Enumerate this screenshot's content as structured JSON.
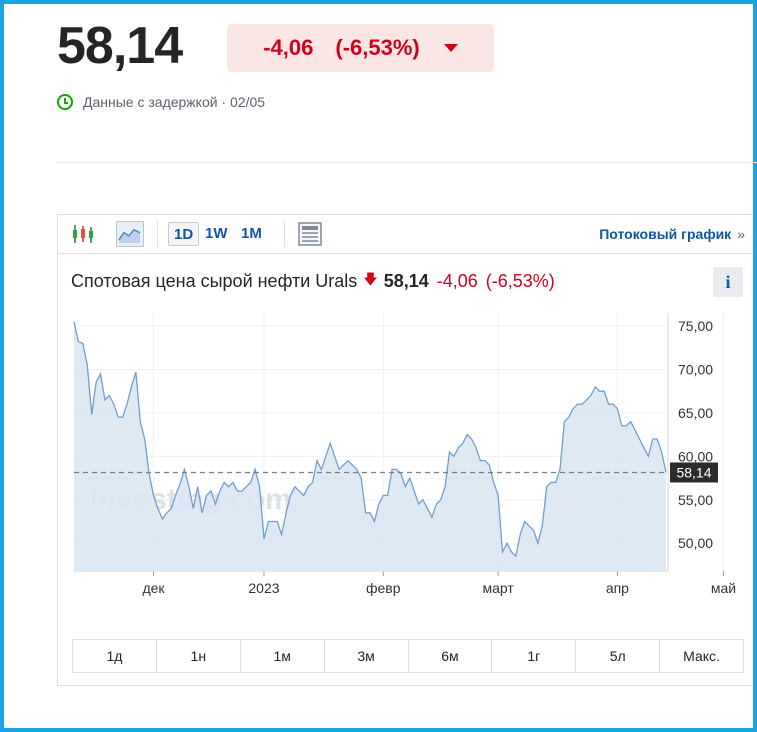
{
  "quote": {
    "price": "58,14",
    "change": "-4,06",
    "change_pct": "(-6,53%)",
    "delay_text": "Данные с задержкой · 02/05"
  },
  "toolbar": {
    "icons": [
      "candlestick-icon",
      "area-chart-icon",
      "table-icon"
    ],
    "timeframes": [
      "1D",
      "1W",
      "1M"
    ],
    "active_timeframe": "1D",
    "stream_label": "Потоковый график",
    "stream_chevron": "»"
  },
  "chart_header": {
    "title": "Спотовая цена сырой нефти Urals",
    "arrow": "🡇",
    "price": "58,14",
    "change": "-4,06",
    "change_pct": "(-6,53%)",
    "info": "i"
  },
  "chart_data": {
    "type": "area",
    "x_labels": [
      "дек",
      "2023",
      "февр",
      "март",
      "апр",
      "май"
    ],
    "y_ticks": [
      "75,00",
      "70,00",
      "65,00",
      "60,00",
      "55,00",
      "50,00"
    ],
    "ylim": [
      46.8,
      76.5
    ],
    "last_value_label": "58,14",
    "last_value": 58.14,
    "watermark": "Investing.com",
    "grid": true,
    "series": [
      {
        "values": [
          75.5,
          73.2,
          73.0,
          70.5,
          64.8,
          68.5,
          69.5,
          66.5,
          67.0,
          66.0,
          64.5,
          64.5,
          66.0,
          68.0,
          69.7,
          64.0,
          62.0,
          58.0,
          55.5,
          54.0,
          52.8,
          53.5,
          54.0,
          55.5,
          56.8,
          58.5,
          56.5,
          54.0,
          56.5,
          53.5,
          55.5,
          56.0,
          54.5,
          56.0,
          57.0,
          56.5,
          57.0,
          56.0,
          56.0,
          56.5,
          57.0,
          58.5,
          56.5,
          50.5,
          52.5,
          52.5,
          52.5,
          51.0,
          53.5,
          55.5,
          56.5,
          56.0,
          55.5,
          56.5,
          57.0,
          59.5,
          58.5,
          60.0,
          61.5,
          60.0,
          58.5,
          59.0,
          59.5,
          59.0,
          58.5,
          57.5,
          53.5,
          53.5,
          52.5,
          54.5,
          55.5,
          55.5,
          58.5,
          58.5,
          58.0,
          56.5,
          57.5,
          56.0,
          54.5,
          55.0,
          54.0,
          53.0,
          54.5,
          55.0,
          56.5,
          60.5,
          60.0,
          61.0,
          61.5,
          62.5,
          62.0,
          61.0,
          59.5,
          59.5,
          59.0,
          57.0,
          55.5,
          49.0,
          50.0,
          49.0,
          48.5,
          51.0,
          52.5,
          52.0,
          51.5,
          50.0,
          52.0,
          56.5,
          57.0,
          57.0,
          58.5,
          64.0,
          64.5,
          65.5,
          66.0,
          66.0,
          66.5,
          67.0,
          68.0,
          67.5,
          67.5,
          66.0,
          66.0,
          65.5,
          63.5,
          63.5,
          64.0,
          63.0,
          62.0,
          61.0,
          60.0,
          62.0,
          62.0,
          60.5,
          58.14
        ]
      }
    ]
  },
  "periods": [
    "1д",
    "1н",
    "1м",
    "3м",
    "6м",
    "1г",
    "5л",
    "Макс."
  ]
}
